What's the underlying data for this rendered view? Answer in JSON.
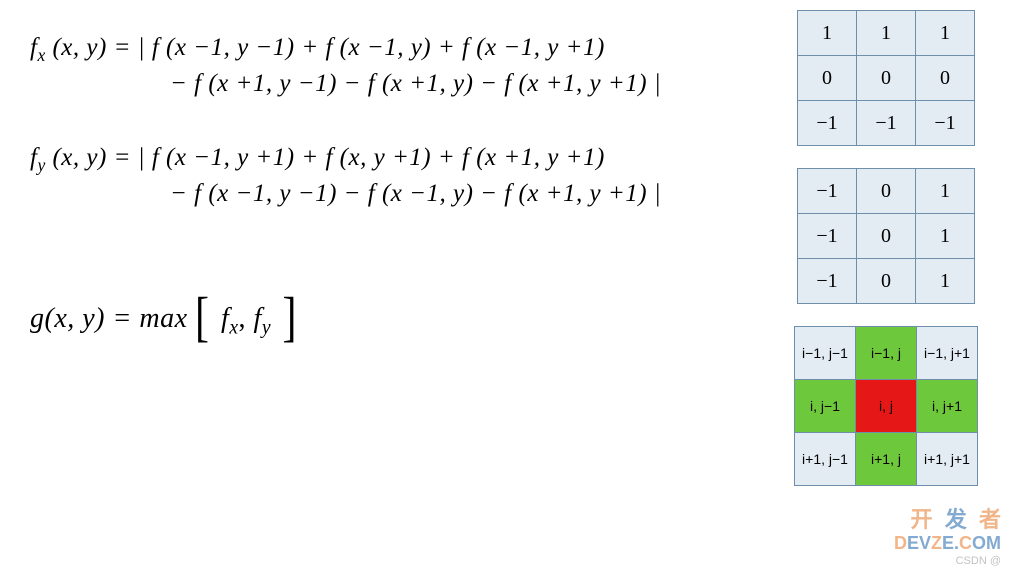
{
  "equations": {
    "fx": {
      "lhs": "f",
      "lhs_sub": "x",
      "lhs_args": "(x, y) =",
      "line1": "| f (x −1, y −1) + f (x −1, y) + f (x −1, y +1)",
      "line2": "− f (x +1, y −1) − f (x +1, y) − f (x +1, y +1) |"
    },
    "fy": {
      "lhs": "f",
      "lhs_sub": "y",
      "lhs_args": "(x, y) =",
      "line1": "| f (x −1, y +1) + f (x, y +1) + f (x +1, y +1)",
      "line2": "− f (x −1, y −1) − f (x −1, y) − f (x +1, y +1) |"
    },
    "g": {
      "lhs": "g",
      "lhs_args": "(x, y) = max",
      "inner_a": "f",
      "inner_a_sub": "x",
      "sep": ", ",
      "inner_b": "f",
      "inner_b_sub": "y"
    }
  },
  "matrices": {
    "kx": [
      [
        "1",
        "1",
        "1"
      ],
      [
        "0",
        "0",
        "0"
      ],
      [
        "−1",
        "−1",
        "−1"
      ]
    ],
    "ky": [
      [
        "−1",
        "0",
        "1"
      ],
      [
        "−1",
        "0",
        "1"
      ],
      [
        "−1",
        "0",
        "1"
      ]
    ],
    "idx": [
      {
        "cells": [
          {
            "t": "i−1, j−1",
            "c": "pale"
          },
          {
            "t": "i−1, j",
            "c": "green"
          },
          {
            "t": "i−1, j+1",
            "c": "pale"
          }
        ]
      },
      {
        "cells": [
          {
            "t": "i, j−1",
            "c": "green"
          },
          {
            "t": "i, j",
            "c": "red"
          },
          {
            "t": "i, j+1",
            "c": "green"
          }
        ]
      },
      {
        "cells": [
          {
            "t": "i+1, j−1",
            "c": "pale"
          },
          {
            "t": "i+1, j",
            "c": "green"
          },
          {
            "t": "i+1, j+1",
            "c": "pale"
          }
        ]
      }
    ]
  },
  "watermark": {
    "line1_a": "开",
    "line1_b": "发",
    "line1_c": "者",
    "line2_a": "D",
    "line2_b": "EV",
    "line2_c": "Z",
    "line2_d": "E.",
    "line2_e": "C",
    "line2_f": "OM",
    "line3": "CSDN @"
  }
}
